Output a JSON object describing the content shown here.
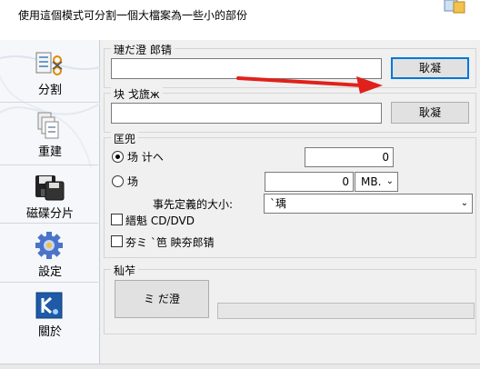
{
  "header": {
    "description": "使用這個模式可分割一個大檔案為一些小的部份"
  },
  "sidebar": {
    "items": [
      {
        "label": "分割",
        "icon": "split-icon"
      },
      {
        "label": "重建",
        "icon": "rebuild-icon"
      },
      {
        "label": "磁碟分片",
        "icon": "disk-span-icon"
      },
      {
        "label": "設定",
        "icon": "settings-gear-icon"
      },
      {
        "label": "關於",
        "icon": "about-logo-icon"
      }
    ]
  },
  "source_group": {
    "title": "璉だ澄  郎锖",
    "input_value": "",
    "browse_label": "耿凝"
  },
  "dest_group": {
    "title": "块  戈旒ж",
    "input_value": "",
    "browse_label": "耿凝"
  },
  "split_group": {
    "title": "匡兜",
    "option_count_label": "场     计ヘ",
    "count_value": "0",
    "option_size_label": "场",
    "size_value": "0",
    "size_unit": "MB.",
    "predefined_label": "事先定義的大小:",
    "predefined_value": "`瑀",
    "cd_dvd_label": "縉魁    CD/DVD",
    "extra_check_label": "夯ミ `笆  眏夯郎锖"
  },
  "progress_group": {
    "title": "秈苲",
    "start_label": "ミ  だ澄",
    "progress_percent": 0
  },
  "colors": {
    "arrow": "#e0211b",
    "accent": "#0078d7"
  }
}
